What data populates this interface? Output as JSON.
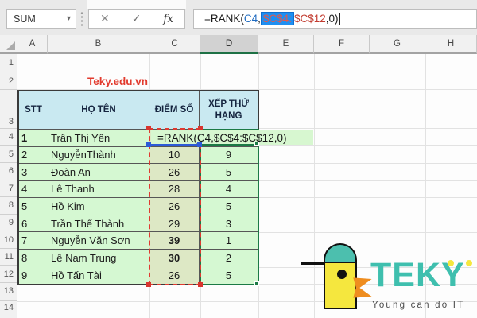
{
  "colors": {
    "accent_green": "#1e7145",
    "reference_blue": "#2d5bd8",
    "reference_red": "#d8352f",
    "selection_blue_bg": "#1e8ff2",
    "table_header_fill": "#c9e9f1",
    "table_data_fill": "#d5f8d2",
    "score_column_fill": "#dde8c5",
    "watermark_red": "#e23b2e",
    "logo_teal": "#3fbfae",
    "logo_yellow": "#f5e73e",
    "logo_orange": "#ef8d1f"
  },
  "formula_bar": {
    "name_box_value": "SUM",
    "dropdown_icon": "▾",
    "cancel_icon": "✕",
    "enter_icon": "✓",
    "fx_icon": "fx",
    "segments": {
      "s0": "=RANK(",
      "s1": "C4",
      "s2": ",",
      "s3": "$C$4:",
      "s4": "$C$12",
      "s5": ",0)"
    }
  },
  "grid": {
    "column_headers": [
      "A",
      "B",
      "C",
      "D",
      "E",
      "F",
      "G",
      "H"
    ],
    "active_column": "D",
    "row_headers": [
      "1",
      "2",
      "3",
      "4",
      "5",
      "6",
      "7",
      "8",
      "9",
      "10",
      "11",
      "12",
      "13",
      "14"
    ]
  },
  "watermark": "Teky.edu.vn",
  "table": {
    "headers": [
      "STT",
      "HỌ TÊN",
      "ĐIỂM SỐ",
      "XẾP THỨ HẠNG"
    ],
    "formula_cell_text": "=RANK(C4,$C$4:$C$12,0)",
    "rows": [
      {
        "stt": "1",
        "name": "Trần Thị Yến",
        "score": "",
        "rank": ""
      },
      {
        "stt": "2",
        "name": "NguyễnThành",
        "score": "10",
        "rank": "9"
      },
      {
        "stt": "3",
        "name": "Đoàn An",
        "score": "26",
        "rank": "5"
      },
      {
        "stt": "4",
        "name": "Lê Thanh",
        "score": "28",
        "rank": "4"
      },
      {
        "stt": "5",
        "name": "Hồ Kim",
        "score": "26",
        "rank": "5"
      },
      {
        "stt": "6",
        "name": "Trần Thế Thành",
        "score": "29",
        "rank": "3"
      },
      {
        "stt": "7",
        "name": "Nguyễn Văn Sơn",
        "score": "39",
        "rank": "1"
      },
      {
        "stt": "8",
        "name": "Lê Nam Trung",
        "score": "30",
        "rank": "2"
      },
      {
        "stt": "9",
        "name": "Hồ Tấn Tài",
        "score": "26",
        "rank": "5"
      }
    ]
  },
  "logo": {
    "brand": "TEKY",
    "tagline": "Young can do IT"
  }
}
